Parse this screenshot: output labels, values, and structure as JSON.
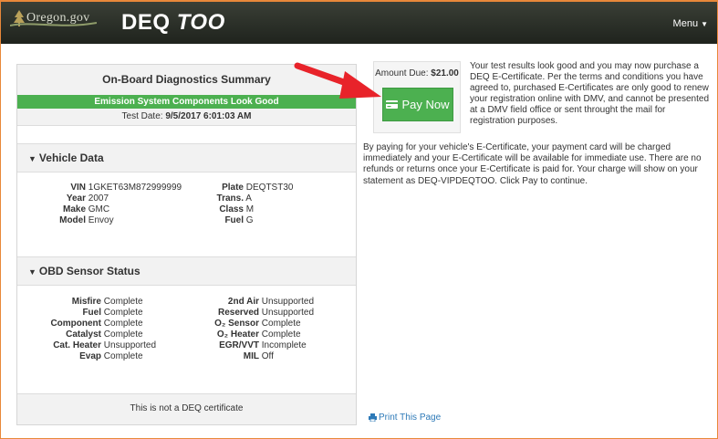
{
  "header": {
    "site_name": "Oregon.gov",
    "app_name_prefix": "DEQ",
    "app_name_suffix": "TOO",
    "menu_label": "Menu"
  },
  "summary": {
    "title": "On-Board Diagnostics Summary",
    "status": "Emission System Components Look Good",
    "test_date_label": "Test Date:",
    "test_date_value": "9/5/2017 6:01:03 AM",
    "vehicle_section": "Vehicle Data",
    "vehicle": [
      {
        "label": "VIN",
        "value": "1GKET63M872999999"
      },
      {
        "label": "Plate",
        "value": "DEQTST30"
      },
      {
        "label": "Year",
        "value": "2007"
      },
      {
        "label": "Trans.",
        "value": "A"
      },
      {
        "label": "Make",
        "value": "GMC"
      },
      {
        "label": "Class",
        "value": "M"
      },
      {
        "label": "Model",
        "value": "Envoy"
      },
      {
        "label": "Fuel",
        "value": "G"
      }
    ],
    "obd_section": "OBD Sensor Status",
    "sensors": [
      {
        "label": "Misfire",
        "value": "Complete"
      },
      {
        "label": "2nd Air",
        "value": "Unsupported"
      },
      {
        "label": "Fuel",
        "value": "Complete"
      },
      {
        "label": "Reserved",
        "value": "Unsupported"
      },
      {
        "label": "Component",
        "value": "Complete"
      },
      {
        "label": "O₂ Sensor",
        "value": "Complete"
      },
      {
        "label": "Catalyst",
        "value": "Complete"
      },
      {
        "label": "O₂ Heater",
        "value": "Complete"
      },
      {
        "label": "Cat. Heater",
        "value": "Unsupported"
      },
      {
        "label": "EGR/VVT",
        "value": "Incomplete"
      },
      {
        "label": "Evap",
        "value": "Complete"
      },
      {
        "label": "MIL",
        "value": "Off"
      }
    ],
    "footer_note": "This is not a DEQ certificate"
  },
  "payment": {
    "amount_label": "Amount Due:",
    "amount_value": "$21.00",
    "pay_button": "Pay Now",
    "message": "Your test results look good and you may now purchase a DEQ E-Certificate. Per the terms and conditions you have agreed to, purchased E-Certificates are only good to renew your registration online with DMV, and cannot be presented at a DMV field office or sent throught the mail for registration purposes.",
    "terms": "By paying for your vehicle's E-Certificate, your payment card will be charged immediately and your E-Certificate will be available for immediate use. There are no refunds or returns once your E-Certificate is paid for. Your charge will show on your statement as DEQ-VIPDEQTOO. Click Pay to continue.",
    "print_link": "Print This Page"
  },
  "colors": {
    "accent_green": "#4cb050",
    "navbar": "#2a2e27",
    "link_blue": "#2e7ab8",
    "arrow_red": "#e8232a",
    "frame_orange": "#e8883a"
  },
  "icons": {
    "brand": "oregon-tree-icon",
    "pay": "credit-card-icon",
    "print": "printer-icon",
    "collapse": "triangle-down-icon"
  }
}
